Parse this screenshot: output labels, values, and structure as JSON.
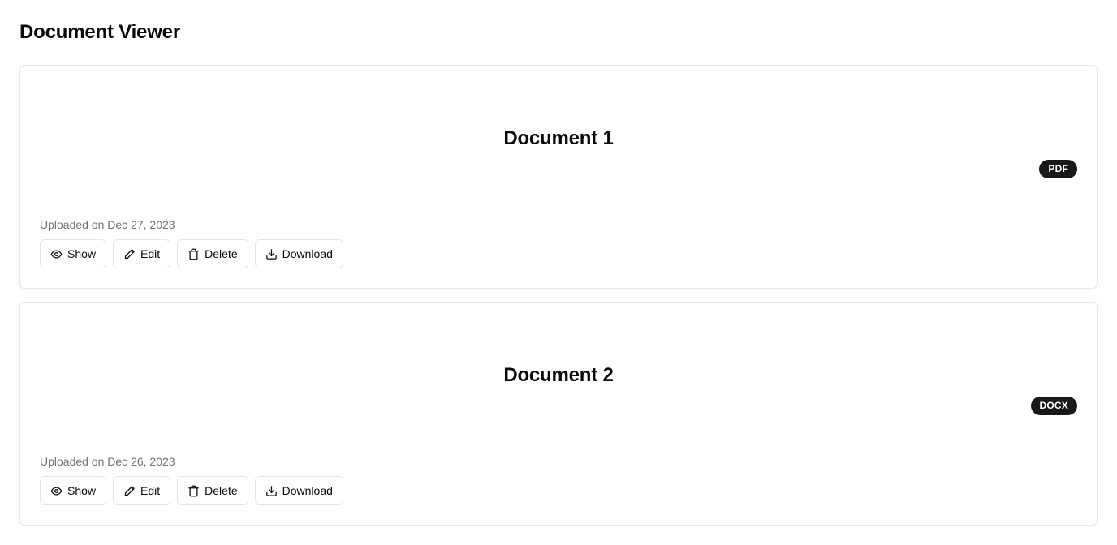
{
  "page": {
    "title": "Document Viewer"
  },
  "documents": [
    {
      "title": "Document 1",
      "type": "PDF",
      "uploaded": "Uploaded on Dec 27, 2023",
      "actions": {
        "show": "Show",
        "edit": "Edit",
        "delete": "Delete",
        "download": "Download"
      }
    },
    {
      "title": "Document 2",
      "type": "DOCX",
      "uploaded": "Uploaded on Dec 26, 2023",
      "actions": {
        "show": "Show",
        "edit": "Edit",
        "delete": "Delete",
        "download": "Download"
      }
    }
  ],
  "icons": {
    "show": "eye-icon",
    "edit": "pencil-icon",
    "delete": "trash-icon",
    "download": "download-icon"
  },
  "colors": {
    "badge_bg": "#18181b",
    "muted_text": "#71717a",
    "border": "#e4e4e7"
  }
}
